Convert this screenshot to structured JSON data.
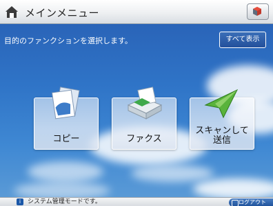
{
  "header": {
    "title": "メインメニュー"
  },
  "main": {
    "instruction": "目的のファンクションを選択します。",
    "show_all_label": "すべて表示",
    "functions": [
      {
        "label": "コピー",
        "icon": "copy-icon"
      },
      {
        "label": "ファクス",
        "icon": "fax-icon"
      },
      {
        "label": "スキャンして\n送信",
        "icon": "scan-send-icon"
      }
    ]
  },
  "status": {
    "message": "システム管理モードです。",
    "logout_label": "ログアウト"
  }
}
